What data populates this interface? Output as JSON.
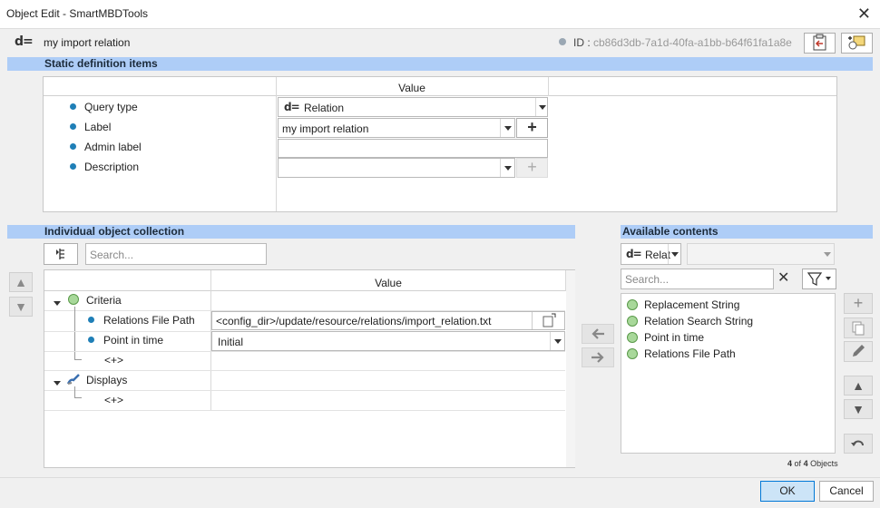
{
  "window": {
    "title": "Object Edit - SmartMBDTools"
  },
  "header": {
    "object_name": "my import relation",
    "id_label": "ID :",
    "id_value": "cb86d3db-7a1d-40fa-a1bb-b64f61fa1a8e"
  },
  "static_section": {
    "title": "Static definition items",
    "value_header": "Value",
    "rows": [
      {
        "label": "Query type",
        "value": "Relation"
      },
      {
        "label": "Label",
        "value": "my import relation"
      },
      {
        "label": "Admin label",
        "value": ""
      },
      {
        "label": "Description",
        "value": ""
      }
    ]
  },
  "collection_section": {
    "title": "Individual object collection",
    "search_placeholder": "Search...",
    "value_header": "Value",
    "tree": {
      "criteria_label": "Criteria",
      "file_path_label": "Relations File Path",
      "file_path_value": "<config_dir>/update/resource/relations/import_relation.txt",
      "point_in_time_label": "Point in time",
      "point_in_time_value": "Initial",
      "add_placeholder_1": "<+>",
      "displays_label": "Displays",
      "add_placeholder_2": "<+>"
    }
  },
  "available_section": {
    "title": "Available contents",
    "type_select": "Relat",
    "search_placeholder": "Search...",
    "items": [
      "Replacement String",
      "Relation Search String",
      "Point in time",
      "Relations File Path"
    ],
    "count_bold": "4",
    "count_mid": "of",
    "count_total": "4",
    "count_suffix": "Objects"
  },
  "footer": {
    "ok_label": "OK",
    "cancel_label": "Cancel"
  },
  "colors": {
    "section_bar": "#aecdf7",
    "bullet_blue": "#1f7fb7",
    "bullet_green": "#a8d89a",
    "ok_button": "#cce4f7"
  },
  "icons": [
    "close-icon",
    "relation-icon",
    "paste-icon",
    "assign-icon",
    "tree-toggle-icon",
    "chevron-down-icon",
    "plus-icon",
    "arrow-up-icon",
    "arrow-down-icon",
    "arrow-left-icon",
    "arrow-right-icon",
    "clear-icon",
    "filter-icon",
    "copy-icon",
    "edit-icon",
    "undo-icon",
    "file-browse-icon",
    "brush-icon"
  ]
}
